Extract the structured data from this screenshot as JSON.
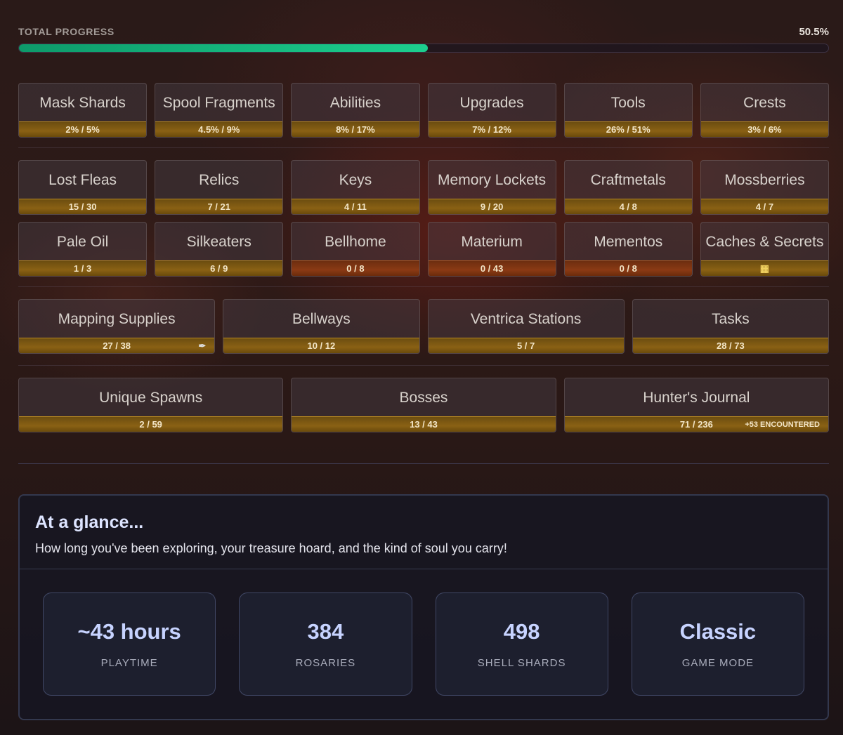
{
  "progress": {
    "label": "TOTAL PROGRESS",
    "value_text": "50.5%",
    "value": 0.505
  },
  "row1": [
    {
      "title": "Mask Shards",
      "value": "2% / 5%"
    },
    {
      "title": "Spool Fragments",
      "value": "4.5% / 9%"
    },
    {
      "title": "Abilities",
      "value": "8% / 17%"
    },
    {
      "title": "Upgrades",
      "value": "7% / 12%"
    },
    {
      "title": "Tools",
      "value": "26% / 51%"
    },
    {
      "title": "Crests",
      "value": "3% / 6%"
    }
  ],
  "row2": [
    {
      "title": "Lost Fleas",
      "value": "15 / 30"
    },
    {
      "title": "Relics",
      "value": "7 / 21"
    },
    {
      "title": "Keys",
      "value": "4 / 11"
    },
    {
      "title": "Memory Lockets",
      "value": "9 / 20"
    },
    {
      "title": "Craftmetals",
      "value": "4 / 8"
    },
    {
      "title": "Mossberries",
      "value": "4 / 7"
    }
  ],
  "row3": [
    {
      "title": "Pale Oil",
      "value": "1 / 3"
    },
    {
      "title": "Silkeaters",
      "value": "6 / 9"
    },
    {
      "title": "Bellhome",
      "value": "0 / 8",
      "status_color": "#8a3a14"
    },
    {
      "title": "Materium",
      "value": "0 / 43",
      "status_color": "#8a3a14"
    },
    {
      "title": "Mementos",
      "value": "0 / 8",
      "status_color": "#8a3a14"
    },
    {
      "title": "Caches & Secrets",
      "value": "",
      "icon": "construction-icon"
    }
  ],
  "row4": [
    {
      "title": "Mapping Supplies",
      "value": "27 / 38",
      "icon": "quill-icon"
    },
    {
      "title": "Bellways",
      "value": "10 / 12"
    },
    {
      "title": "Ventrica Stations",
      "value": "5 / 7"
    },
    {
      "title": "Tasks",
      "value": "28 / 73"
    }
  ],
  "row5": [
    {
      "title": "Unique Spawns",
      "value": "2 / 59"
    },
    {
      "title": "Bosses",
      "value": "13 / 43"
    },
    {
      "title": "Hunter's Journal",
      "value": "71 / 236",
      "extra": "+53 ENCOUNTERED"
    }
  ],
  "glance": {
    "title": "At a glance...",
    "subtitle": "How long you've been exploring, your treasure hoard, and the kind of soul you carry!",
    "stats": [
      {
        "value": "~43 hours",
        "label": "PLAYTIME"
      },
      {
        "value": "384",
        "label": "ROSARIES"
      },
      {
        "value": "498",
        "label": "SHELL SHARDS"
      },
      {
        "value": "Classic",
        "label": "GAME MODE"
      }
    ]
  },
  "colors": {
    "progress_fill": "#1ccf8e",
    "bar_gold": "#8a6114",
    "bar_red": "#8a3a14",
    "accent_blue": "#c7d3ff"
  }
}
